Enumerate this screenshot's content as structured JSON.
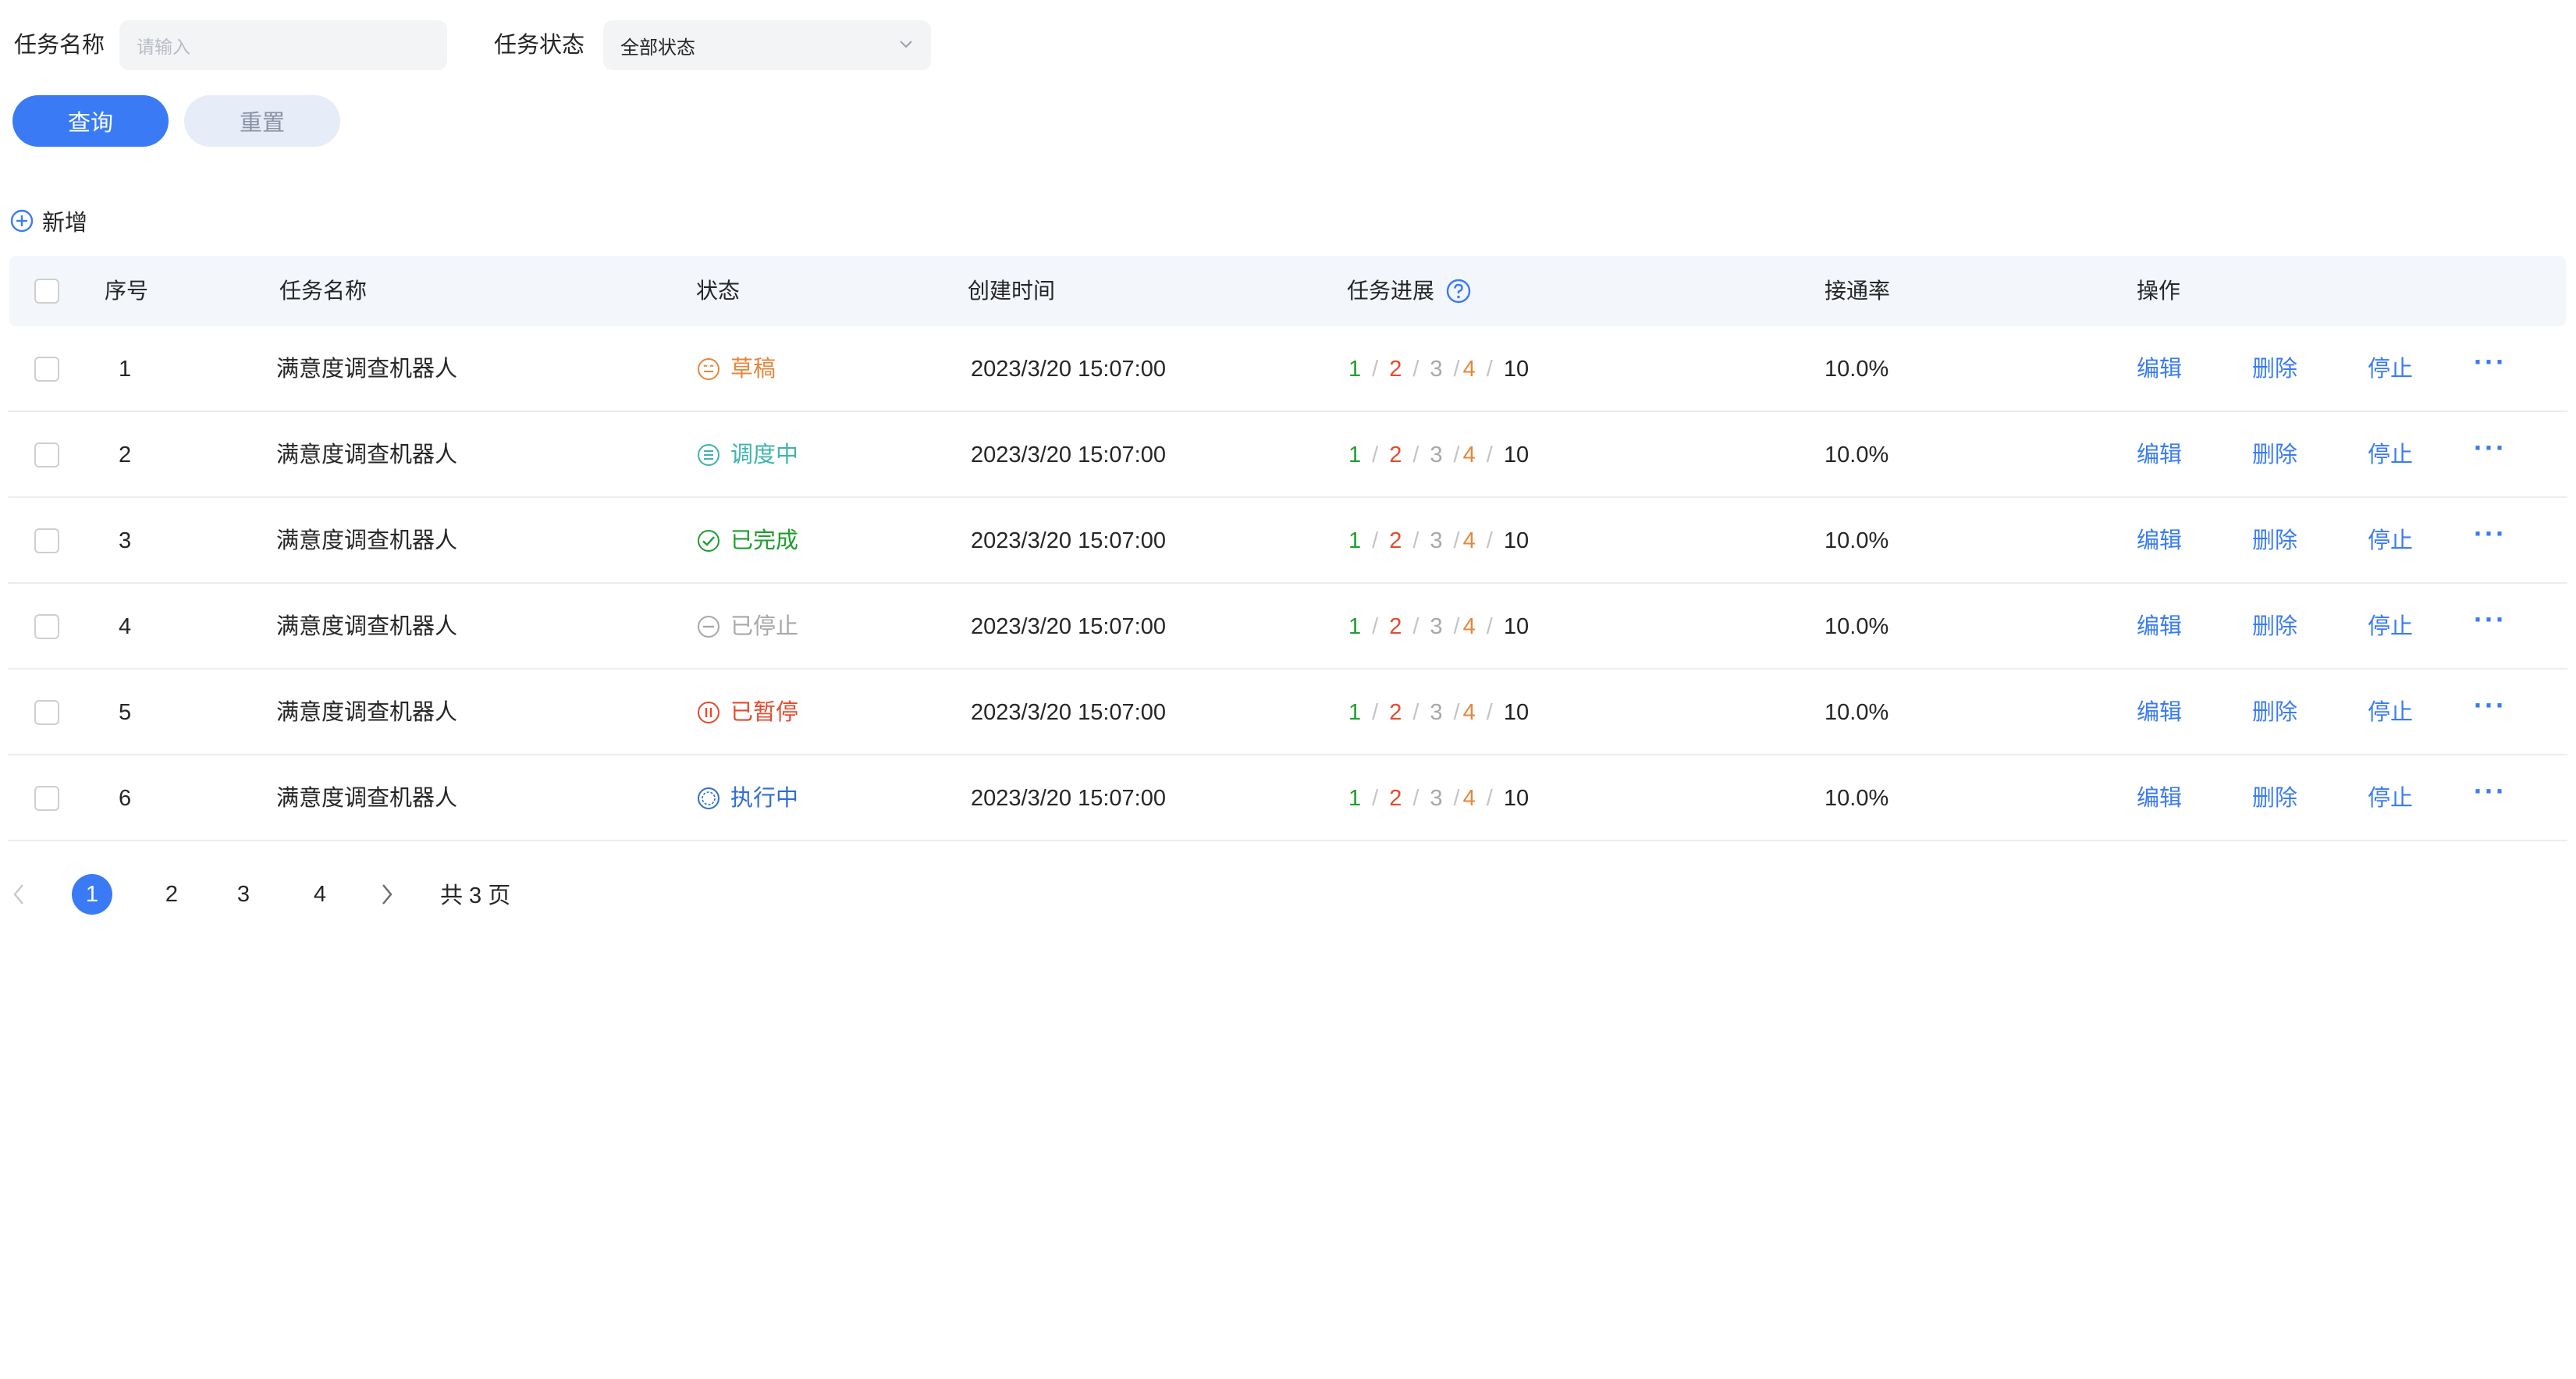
{
  "filters": {
    "task_name_label": "任务名称",
    "task_name_placeholder": "请输入",
    "task_status_label": "任务状态",
    "task_status_value": "全部状态",
    "query_button": "查询",
    "reset_button": "重置"
  },
  "toolbar": {
    "add_label": "新增"
  },
  "table": {
    "headers": {
      "index": "序号",
      "name": "任务名称",
      "status": "状态",
      "created": "创建时间",
      "progress": "任务进展",
      "rate": "接通率",
      "actions": "操作"
    },
    "rows": [
      {
        "index": "1",
        "name": "满意度调查机器人",
        "status": "草稿",
        "status_color": "#e6863a",
        "created": "2023/3/20 15:07:00",
        "p1": "1",
        "p2": "2",
        "p3": "3",
        "p4": "4",
        "total": "10",
        "rate": "10.0%",
        "edit": "编辑",
        "delete": "删除",
        "stop": "停止",
        "more": "···"
      },
      {
        "index": "2",
        "name": "满意度调查机器人",
        "status": "调度中",
        "status_color": "#3fb3ae",
        "created": "2023/3/20 15:07:00",
        "p1": "1",
        "p2": "2",
        "p3": "3",
        "p4": "4",
        "total": "10",
        "rate": "10.0%",
        "edit": "编辑",
        "delete": "删除",
        "stop": "停止",
        "more": "···"
      },
      {
        "index": "3",
        "name": "满意度调查机器人",
        "status": "已完成",
        "status_color": "#1f9e2e",
        "created": "2023/3/20 15:07:00",
        "p1": "1",
        "p2": "2",
        "p3": "3",
        "p4": "4",
        "total": "10",
        "rate": "10.0%",
        "edit": "编辑",
        "delete": "删除",
        "stop": "停止",
        "more": "···"
      },
      {
        "index": "4",
        "name": "满意度调查机器人",
        "status": "已停止",
        "status_color": "#a8a8a8",
        "created": "2023/3/20 15:07:00",
        "p1": "1",
        "p2": "2",
        "p3": "3",
        "p4": "4",
        "total": "10",
        "rate": "10.0%",
        "edit": "编辑",
        "delete": "删除",
        "stop": "停止",
        "more": "···"
      },
      {
        "index": "5",
        "name": "满意度调查机器人",
        "status": "已暂停",
        "status_color": "#e64a2e",
        "created": "2023/3/20 15:07:00",
        "p1": "1",
        "p2": "2",
        "p3": "3",
        "p4": "4",
        "total": "10",
        "rate": "10.0%",
        "edit": "编辑",
        "delete": "删除",
        "stop": "停止",
        "more": "···"
      },
      {
        "index": "6",
        "name": "满意度调查机器人",
        "status": "执行中",
        "status_color": "#2f6fd6",
        "created": "2023/3/20 15:07:00",
        "p1": "1",
        "p2": "2",
        "p3": "3",
        "p4": "4",
        "total": "10",
        "rate": "10.0%",
        "edit": "编辑",
        "delete": "删除",
        "stop": "停止",
        "more": "···"
      }
    ]
  },
  "pagination": {
    "pages": [
      "1",
      "2",
      "3",
      "4"
    ],
    "current": "1",
    "total_text": "共 3 页"
  },
  "colors": {
    "accent": "#3a7bf5",
    "progress_1": "#1f9e2e",
    "progress_2": "#e64a2e",
    "progress_3": "#a8a8a8",
    "progress_4": "#e6863a"
  }
}
